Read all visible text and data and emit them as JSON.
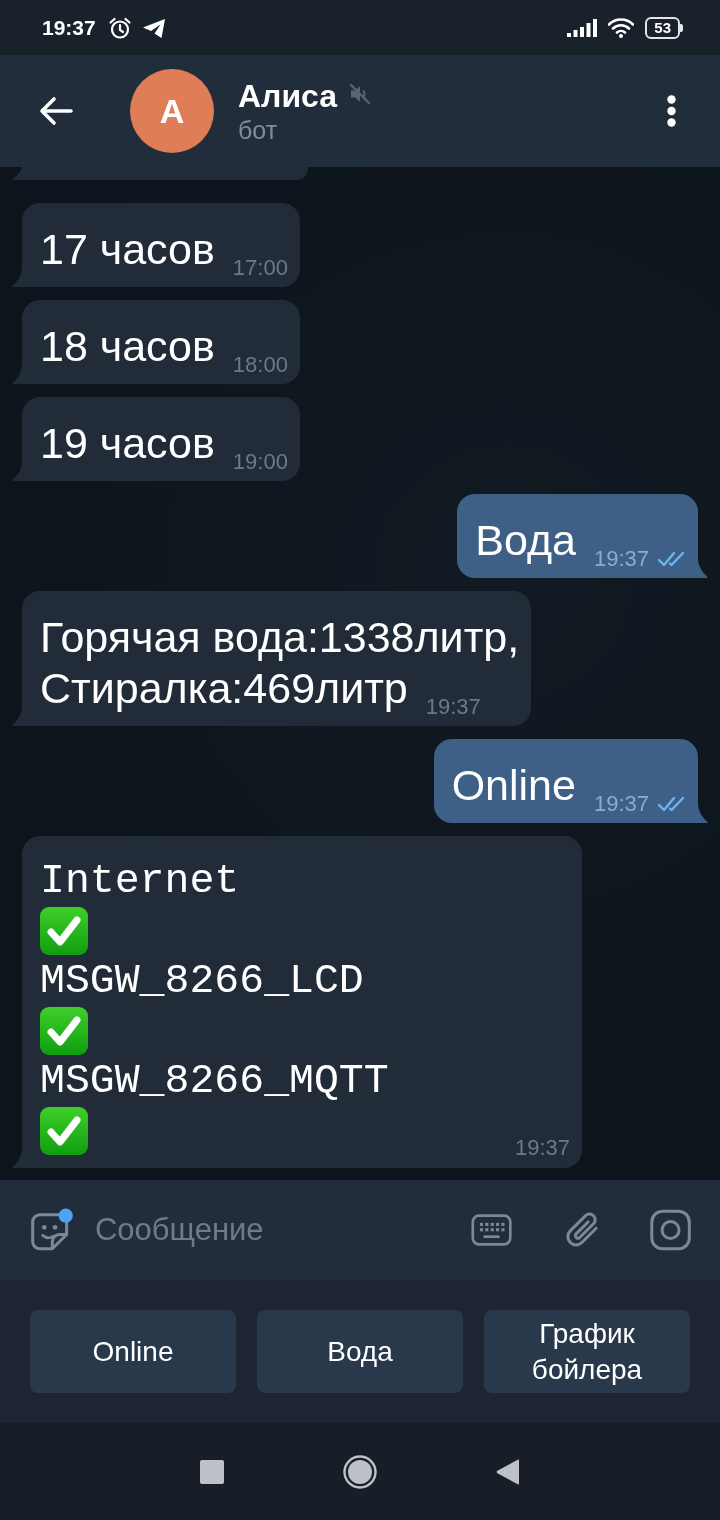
{
  "status_bar": {
    "time": "19:37",
    "battery": "53"
  },
  "header": {
    "title": "Алиса",
    "subtitle": "бот",
    "avatar_letter": "А",
    "muted": true
  },
  "messages": [
    {
      "kind": "text",
      "outgoing": false,
      "text": "17 часов",
      "time": "17:00"
    },
    {
      "kind": "text",
      "outgoing": false,
      "text": "18 часов",
      "time": "18:00"
    },
    {
      "kind": "text",
      "outgoing": false,
      "text": "19 часов",
      "time": "19:00"
    },
    {
      "kind": "text",
      "outgoing": true,
      "text": "Вода",
      "time": "19:37",
      "read": true
    },
    {
      "kind": "text",
      "outgoing": false,
      "text": "Горячая вода:1338литр,\nСтиралка:469литр",
      "time": "19:37"
    },
    {
      "kind": "text",
      "outgoing": true,
      "text": "Online",
      "time": "19:37",
      "read": true
    },
    {
      "kind": "status_list",
      "outgoing": false,
      "entries": [
        {
          "label": "Internet",
          "ok": true
        },
        {
          "label": "MSGW_8266_LCD",
          "ok": true
        },
        {
          "label": "MSGW_8266_MQTT",
          "ok": true
        }
      ],
      "time": "19:37"
    }
  ],
  "composer": {
    "placeholder": "Сообщение"
  },
  "reply_keyboard": [
    "Online",
    "Вода",
    "График бойлера"
  ]
}
